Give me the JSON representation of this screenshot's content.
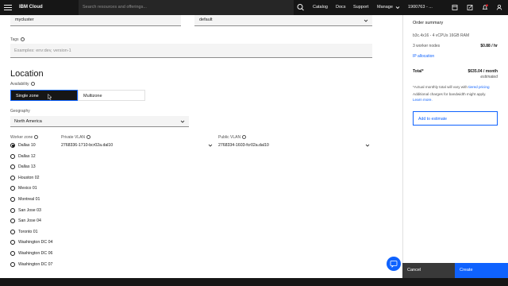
{
  "topbar": {
    "brand": "IBM Cloud",
    "search_placeholder": "Search resources and offerings...",
    "nav": [
      "Catalog",
      "Docs",
      "Support",
      "Manage"
    ],
    "account": "1900763 - ..."
  },
  "form": {
    "cluster_name_value": "mycluster",
    "resource_group_value": "default",
    "tags_label": "Tags",
    "tags_placeholder": "Examples: env:dev, version-1",
    "location_heading": "Location",
    "availability_label": "Availability",
    "availability_options": [
      "Single zone",
      "Multizone"
    ],
    "availability_selected": "Single zone",
    "geography_label": "Geography",
    "geography_value": "North America",
    "worker_zone_label": "Worker zone",
    "private_vlan_label": "Private VLAN",
    "private_vlan_value": "2768336-1710-bcr02a.dal10",
    "public_vlan_label": "Public VLAN",
    "public_vlan_value": "2768334-1603-fcr02a.dal10",
    "worker_zones": [
      "Dallas 10",
      "Dallas 12",
      "Dallas 13",
      "Houston 02",
      "Mexico 01",
      "Montreal 01",
      "San Jose 03",
      "San Jose 04",
      "Toronto 01",
      "Washington DC 04",
      "Washington DC 06",
      "Washington DC 07"
    ],
    "worker_zone_selected": "Dallas 10"
  },
  "summary": {
    "title": "Order summary",
    "flavor": "b3c.4x16 - 4 vCPUs 16GB RAM",
    "workers": "3 worker nodes",
    "worker_price": "$0.88 / hr",
    "ip_allocation": "IP allocation",
    "total_label": "Total*",
    "total_value": "$635.04 / month",
    "total_note": "estimated",
    "note_1a": "*Actual monthly total will vary with",
    "note_1b": "tiered pricing",
    "note_2a": "Additional charges for bandwidth might apply.",
    "note_2b": "Learn more.",
    "add_to_estimate": "Add to estimate"
  },
  "actions": {
    "cancel": "Cancel",
    "create": "Create"
  },
  "colors": {
    "accent": "#0f62fe",
    "topbar": "#161616",
    "field_bg": "#f4f4f4",
    "notification_dot": "#da1e28"
  }
}
